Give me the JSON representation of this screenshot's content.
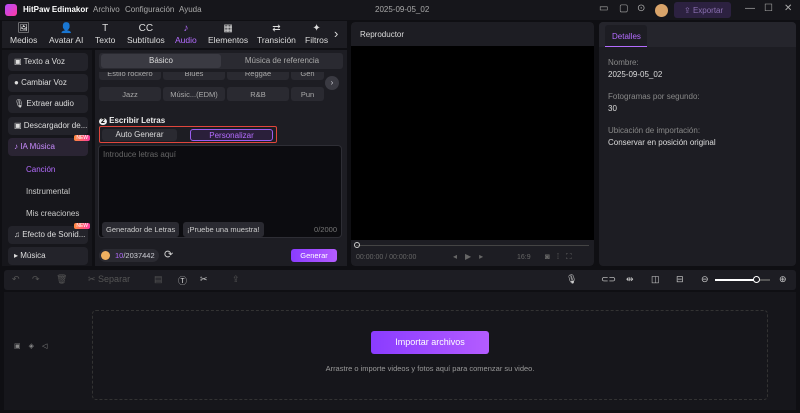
{
  "app": {
    "title": "HitPaw Edimakor",
    "menu": [
      "Archivo",
      "Configuración",
      "Ayuda"
    ],
    "project": "2025-09-05_02",
    "export": "Exportar"
  },
  "tabs": [
    {
      "label": "Medios",
      "icon": "🖼"
    },
    {
      "label": "Avatar AI",
      "icon": "👤"
    },
    {
      "label": "Texto",
      "icon": "T"
    },
    {
      "label": "Subtítulos",
      "icon": "CC"
    },
    {
      "label": "Audio",
      "icon": "♪"
    },
    {
      "label": "Elementos",
      "icon": "▦"
    },
    {
      "label": "Transición",
      "icon": "⇄"
    },
    {
      "label": "Filtros",
      "icon": "✦"
    }
  ],
  "sidebar": {
    "items": [
      "Texto a Voz",
      "Cambiar Voz",
      "Extraer audio",
      "Descargador de...",
      "IA Música",
      "Efecto de Sonid...",
      "Música"
    ],
    "sub": [
      "Canción",
      "Instrumental",
      "Mis creaciones"
    ],
    "new_badge": "NEW"
  },
  "audio": {
    "seg": [
      "Básico",
      "Música de referencia"
    ],
    "genres_row1": [
      "Estilo rockero",
      "Blues",
      "Reggae",
      "Gen"
    ],
    "genres_row2": [
      "Jazz",
      "Músic...(EDM)",
      "R&B",
      "Pun"
    ],
    "lyrics_title": "Escribir Letras",
    "step": "2",
    "modes": [
      "Auto Generar",
      "Personalizar"
    ],
    "placeholder": "Introduce letras aquí",
    "lyrics_gen": "Generador de Letras",
    "sample": "¡Pruebe una muestra!",
    "count": "0/2000",
    "credits_used": "10",
    "credits_total": "/2037442",
    "generate": "Generar"
  },
  "player": {
    "title": "Reproductor",
    "time": "00:00:00 / 00:00:00",
    "ratio": "16:9"
  },
  "details": {
    "tab": "Detalles",
    "name_label": "Nombre:",
    "name": "2025-09-05_02",
    "fps_label": "Fotogramas por segundo:",
    "fps": "30",
    "loc_label": "Ubicación de importación:",
    "loc": "Conservar en posición original"
  },
  "timeline": {
    "split": "Separar",
    "import": "Importar archivos",
    "hint": "Arrastre o importe videos y fotos aquí para comenzar su video.",
    "zoom_level": 0.75
  }
}
